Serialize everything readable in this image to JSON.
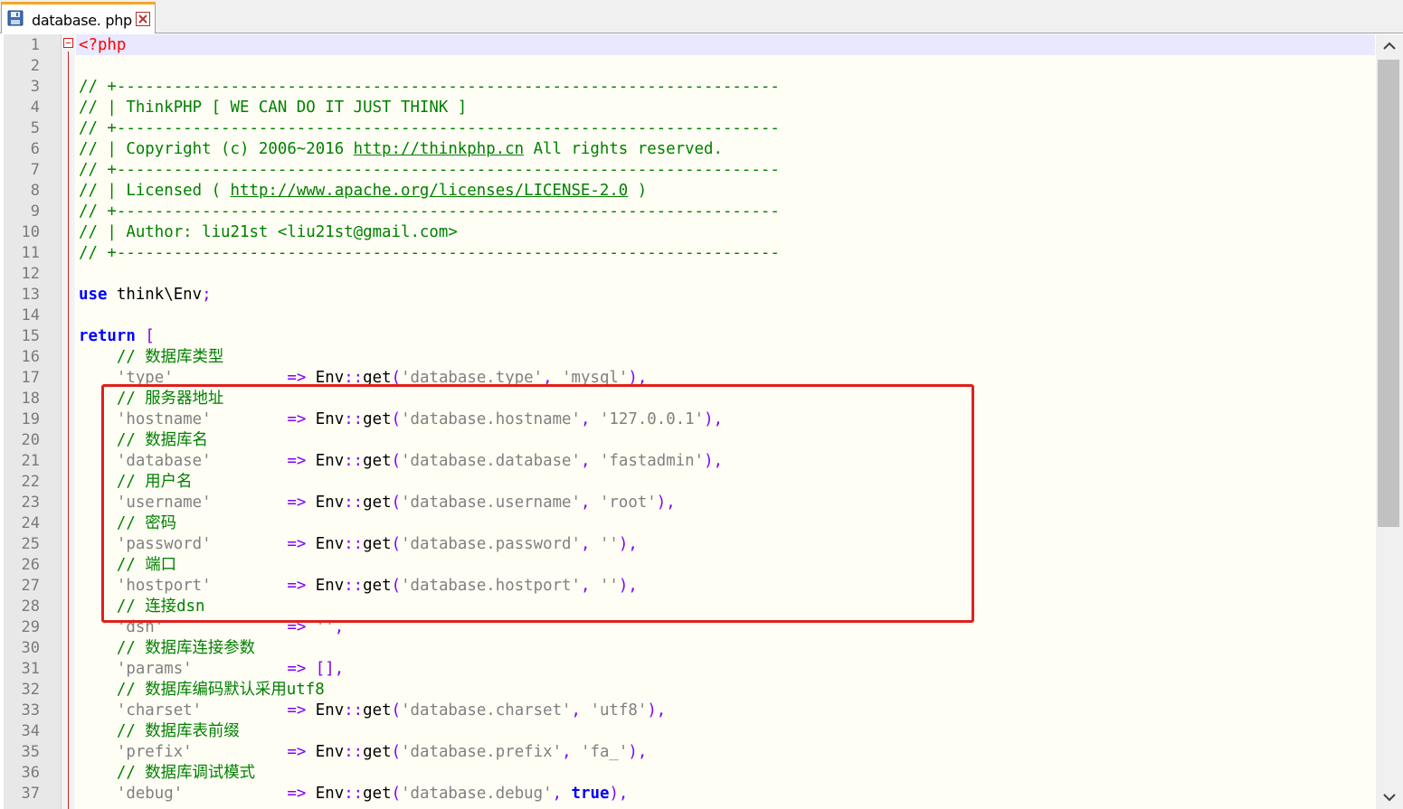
{
  "tab": {
    "filename": "database. php",
    "icon": "save-disk-icon",
    "close_icon": "close-icon"
  },
  "editor": {
    "lines": [
      {
        "n": "1",
        "segs": [
          {
            "t": "<?php",
            "c": "tg"
          }
        ]
      },
      {
        "n": "2",
        "segs": []
      },
      {
        "n": "3",
        "segs": [
          {
            "t": "// +----------------------------------------------------------------------",
            "c": "cm"
          }
        ]
      },
      {
        "n": "4",
        "segs": [
          {
            "t": "// | ThinkPHP [ WE CAN DO IT JUST THINK ]",
            "c": "cm"
          }
        ]
      },
      {
        "n": "5",
        "segs": [
          {
            "t": "// +----------------------------------------------------------------------",
            "c": "cm"
          }
        ]
      },
      {
        "n": "6",
        "segs": [
          {
            "t": "// | Copyright (c) 2006~2016 ",
            "c": "cm"
          },
          {
            "t": "http://thinkphp.cn",
            "c": "url"
          },
          {
            "t": " All rights reserved.",
            "c": "cm"
          }
        ]
      },
      {
        "n": "7",
        "segs": [
          {
            "t": "// +----------------------------------------------------------------------",
            "c": "cm"
          }
        ]
      },
      {
        "n": "8",
        "segs": [
          {
            "t": "// | Licensed ( ",
            "c": "cm"
          },
          {
            "t": "http://www.apache.org/licenses/LICENSE-2.0",
            "c": "url"
          },
          {
            "t": " )",
            "c": "cm"
          }
        ]
      },
      {
        "n": "9",
        "segs": [
          {
            "t": "// +----------------------------------------------------------------------",
            "c": "cm"
          }
        ]
      },
      {
        "n": "10",
        "segs": [
          {
            "t": "// | Author: liu21st <liu21st@gmail.com>",
            "c": "cm"
          }
        ]
      },
      {
        "n": "11",
        "segs": [
          {
            "t": "// +----------------------------------------------------------------------",
            "c": "cm"
          }
        ]
      },
      {
        "n": "12",
        "segs": []
      },
      {
        "n": "13",
        "segs": [
          {
            "t": "use",
            "c": "kw"
          },
          {
            "t": " think\\Env"
          },
          {
            "t": ";",
            "c": "op"
          }
        ]
      },
      {
        "n": "14",
        "segs": []
      },
      {
        "n": "15",
        "segs": [
          {
            "t": "return",
            "c": "kw"
          },
          {
            "t": " "
          },
          {
            "t": "[",
            "c": "op"
          }
        ]
      },
      {
        "n": "16",
        "segs": [
          {
            "t": "    // 数据库类型",
            "c": "cm"
          }
        ]
      },
      {
        "n": "17",
        "segs": [
          {
            "t": "    "
          },
          {
            "t": "'type'",
            "c": "st"
          },
          {
            "t": "            "
          },
          {
            "t": "=>",
            "c": "op"
          },
          {
            "t": " Env"
          },
          {
            "t": "::",
            "c": "op"
          },
          {
            "t": "get"
          },
          {
            "t": "(",
            "c": "op"
          },
          {
            "t": "'database.type'",
            "c": "st"
          },
          {
            "t": ", ",
            "c": "op"
          },
          {
            "t": "'mysql'",
            "c": "st"
          },
          {
            "t": "),",
            "c": "op"
          }
        ]
      },
      {
        "n": "18",
        "segs": [
          {
            "t": "    // 服务器地址",
            "c": "cm"
          }
        ]
      },
      {
        "n": "19",
        "segs": [
          {
            "t": "    "
          },
          {
            "t": "'hostname'",
            "c": "st"
          },
          {
            "t": "        "
          },
          {
            "t": "=>",
            "c": "op"
          },
          {
            "t": " Env"
          },
          {
            "t": "::",
            "c": "op"
          },
          {
            "t": "get"
          },
          {
            "t": "(",
            "c": "op"
          },
          {
            "t": "'database.hostname'",
            "c": "st"
          },
          {
            "t": ", ",
            "c": "op"
          },
          {
            "t": "'127.0.0.1'",
            "c": "st"
          },
          {
            "t": "),",
            "c": "op"
          }
        ]
      },
      {
        "n": "20",
        "segs": [
          {
            "t": "    // 数据库名",
            "c": "cm"
          }
        ]
      },
      {
        "n": "21",
        "segs": [
          {
            "t": "    "
          },
          {
            "t": "'database'",
            "c": "st"
          },
          {
            "t": "        "
          },
          {
            "t": "=>",
            "c": "op"
          },
          {
            "t": " Env"
          },
          {
            "t": "::",
            "c": "op"
          },
          {
            "t": "get"
          },
          {
            "t": "(",
            "c": "op"
          },
          {
            "t": "'database.database'",
            "c": "st"
          },
          {
            "t": ", ",
            "c": "op"
          },
          {
            "t": "'fastadmin'",
            "c": "st"
          },
          {
            "t": "),",
            "c": "op"
          }
        ]
      },
      {
        "n": "22",
        "segs": [
          {
            "t": "    // 用户名",
            "c": "cm"
          }
        ]
      },
      {
        "n": "23",
        "segs": [
          {
            "t": "    "
          },
          {
            "t": "'username'",
            "c": "st"
          },
          {
            "t": "        "
          },
          {
            "t": "=>",
            "c": "op"
          },
          {
            "t": " Env"
          },
          {
            "t": "::",
            "c": "op"
          },
          {
            "t": "get"
          },
          {
            "t": "(",
            "c": "op"
          },
          {
            "t": "'database.username'",
            "c": "st"
          },
          {
            "t": ", ",
            "c": "op"
          },
          {
            "t": "'root'",
            "c": "st"
          },
          {
            "t": "),",
            "c": "op"
          }
        ]
      },
      {
        "n": "24",
        "segs": [
          {
            "t": "    // 密码",
            "c": "cm"
          }
        ]
      },
      {
        "n": "25",
        "segs": [
          {
            "t": "    "
          },
          {
            "t": "'password'",
            "c": "st"
          },
          {
            "t": "        "
          },
          {
            "t": "=>",
            "c": "op"
          },
          {
            "t": " Env"
          },
          {
            "t": "::",
            "c": "op"
          },
          {
            "t": "get"
          },
          {
            "t": "(",
            "c": "op"
          },
          {
            "t": "'database.password'",
            "c": "st"
          },
          {
            "t": ", ",
            "c": "op"
          },
          {
            "t": "''",
            "c": "st"
          },
          {
            "t": "),",
            "c": "op"
          }
        ]
      },
      {
        "n": "26",
        "segs": [
          {
            "t": "    // 端口",
            "c": "cm"
          }
        ]
      },
      {
        "n": "27",
        "segs": [
          {
            "t": "    "
          },
          {
            "t": "'hostport'",
            "c": "st"
          },
          {
            "t": "        "
          },
          {
            "t": "=>",
            "c": "op"
          },
          {
            "t": " Env"
          },
          {
            "t": "::",
            "c": "op"
          },
          {
            "t": "get"
          },
          {
            "t": "(",
            "c": "op"
          },
          {
            "t": "'database.hostport'",
            "c": "st"
          },
          {
            "t": ", ",
            "c": "op"
          },
          {
            "t": "''",
            "c": "st"
          },
          {
            "t": "),",
            "c": "op"
          }
        ]
      },
      {
        "n": "28",
        "segs": [
          {
            "t": "    // 连接dsn",
            "c": "cm"
          }
        ]
      },
      {
        "n": "29",
        "segs": [
          {
            "t": "    "
          },
          {
            "t": "'dsn'",
            "c": "st"
          },
          {
            "t": "             "
          },
          {
            "t": "=>",
            "c": "op"
          },
          {
            "t": " "
          },
          {
            "t": "''",
            "c": "st"
          },
          {
            "t": ",",
            "c": "op"
          }
        ]
      },
      {
        "n": "30",
        "segs": [
          {
            "t": "    // 数据库连接参数",
            "c": "cm"
          }
        ]
      },
      {
        "n": "31",
        "segs": [
          {
            "t": "    "
          },
          {
            "t": "'params'",
            "c": "st"
          },
          {
            "t": "          "
          },
          {
            "t": "=>",
            "c": "op"
          },
          {
            "t": " "
          },
          {
            "t": "[],",
            "c": "op"
          }
        ]
      },
      {
        "n": "32",
        "segs": [
          {
            "t": "    // 数据库编码默认采用utf8",
            "c": "cm"
          }
        ]
      },
      {
        "n": "33",
        "segs": [
          {
            "t": "    "
          },
          {
            "t": "'charset'",
            "c": "st"
          },
          {
            "t": "         "
          },
          {
            "t": "=>",
            "c": "op"
          },
          {
            "t": " Env"
          },
          {
            "t": "::",
            "c": "op"
          },
          {
            "t": "get"
          },
          {
            "t": "(",
            "c": "op"
          },
          {
            "t": "'database.charset'",
            "c": "st"
          },
          {
            "t": ", ",
            "c": "op"
          },
          {
            "t": "'utf8'",
            "c": "st"
          },
          {
            "t": "),",
            "c": "op"
          }
        ]
      },
      {
        "n": "34",
        "segs": [
          {
            "t": "    // 数据库表前缀",
            "c": "cm"
          }
        ]
      },
      {
        "n": "35",
        "segs": [
          {
            "t": "    "
          },
          {
            "t": "'prefix'",
            "c": "st"
          },
          {
            "t": "          "
          },
          {
            "t": "=>",
            "c": "op"
          },
          {
            "t": " Env"
          },
          {
            "t": "::",
            "c": "op"
          },
          {
            "t": "get"
          },
          {
            "t": "(",
            "c": "op"
          },
          {
            "t": "'database.prefix'",
            "c": "st"
          },
          {
            "t": ", ",
            "c": "op"
          },
          {
            "t": "'fa_'",
            "c": "st"
          },
          {
            "t": "),",
            "c": "op"
          }
        ]
      },
      {
        "n": "36",
        "segs": [
          {
            "t": "    // 数据库调试模式",
            "c": "cm"
          }
        ]
      },
      {
        "n": "37",
        "segs": [
          {
            "t": "    "
          },
          {
            "t": "'debug'",
            "c": "st"
          },
          {
            "t": "           "
          },
          {
            "t": "=>",
            "c": "op"
          },
          {
            "t": " Env"
          },
          {
            "t": "::",
            "c": "op"
          },
          {
            "t": "get"
          },
          {
            "t": "(",
            "c": "op"
          },
          {
            "t": "'database.debug'",
            "c": "st"
          },
          {
            "t": ", ",
            "c": "op"
          },
          {
            "t": "true",
            "c": "kw"
          },
          {
            "t": "),",
            "c": "op"
          }
        ]
      }
    ]
  },
  "colors": {
    "comment": "#008000",
    "keyword": "#0000ff",
    "string": "#808080",
    "operator": "#8000ff",
    "php_tag": "#ff0000",
    "highlight_box": "#e0201c",
    "tab_accent": "#f6a623",
    "current_line": "#e8e8ff"
  },
  "scrollbar": {
    "up_icon": "scroll-up-arrow-icon",
    "down_icon": "scroll-down-arrow-icon"
  }
}
